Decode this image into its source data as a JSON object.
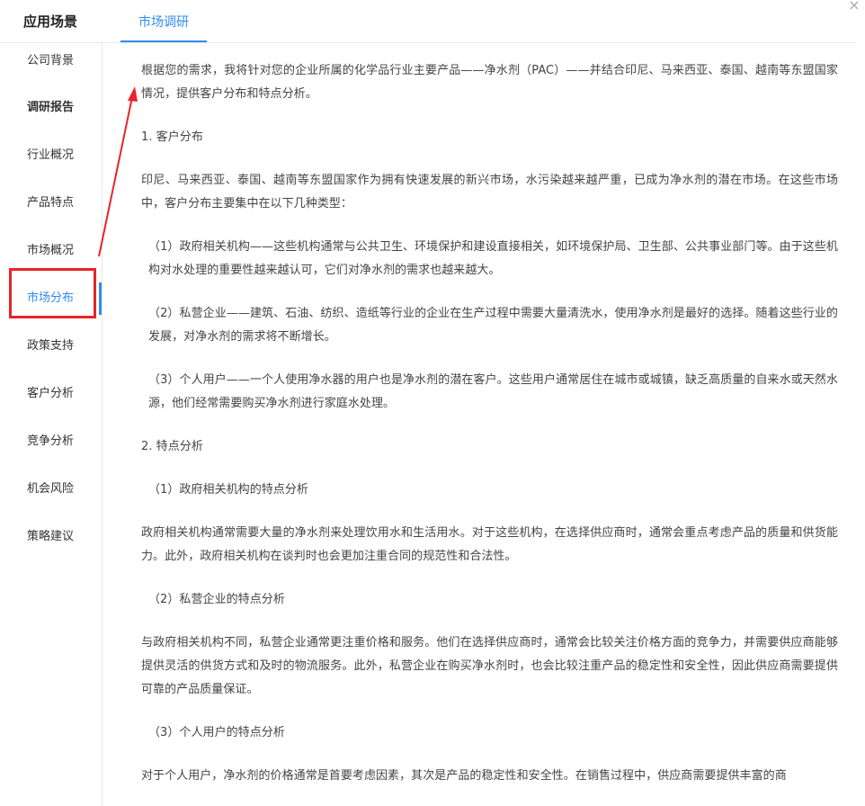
{
  "header": {
    "title": "应用场景",
    "tab_label": "市场调研",
    "close_glyph": "×"
  },
  "sidebar": {
    "items": [
      {
        "label": "公司背景"
      },
      {
        "label": "调研报告"
      },
      {
        "label": "行业概况"
      },
      {
        "label": "产品特点"
      },
      {
        "label": "市场概况"
      },
      {
        "label": "市场分布"
      },
      {
        "label": "政策支持"
      },
      {
        "label": "客户分析"
      },
      {
        "label": "竞争分析"
      },
      {
        "label": "机会风险"
      },
      {
        "label": "策略建议"
      }
    ],
    "active_label": "市场分布"
  },
  "content": {
    "paragraphs": [
      "根据您的需求，我将针对您的企业所属的化学品行业主要产品——净水剂（PAC）——并结合印尼、马来西亚、泰国、越南等东盟国家情况，提供客户分布和特点分析。",
      "1. 客户分布",
      "印尼、马来西亚、泰国、越南等东盟国家作为拥有快速发展的新兴市场，水污染越来越严重，已成为净水剂的潜在市场。在这些市场中，客户分布主要集中在以下几种类型：",
      "（1）政府相关机构——这些机构通常与公共卫生、环境保护和建设直接相关，如环境保护局、卫生部、公共事业部门等。由于这些机构对水处理的重要性越来越认可，它们对净水剂的需求也越来越大。",
      "（2）私营企业——建筑、石油、纺织、造纸等行业的企业在生产过程中需要大量清洗水，使用净水剂是最好的选择。随着这些行业的发展，对净水剂的需求将不断增长。",
      "（3）个人用户——一个人使用净水器的用户也是净水剂的潜在客户。这些用户通常居住在城市或城镇，缺乏高质量的自来水或天然水源，他们经常需要购买净水剂进行家庭水处理。",
      "2. 特点分析",
      "（1）政府相关机构的特点分析",
      "政府相关机构通常需要大量的净水剂来处理饮用水和生活用水。对于这些机构，在选择供应商时，通常会重点考虑产品的质量和供货能力。此外，政府相关机构在谈判时也会更加注重合同的规范性和合法性。",
      "（2）私营企业的特点分析",
      "与政府相关机构不同，私营企业通常更注重价格和服务。他们在选择供应商时，通常会比较关注价格方面的竞争力，并需要供应商能够提供灵活的供货方式和及时的物流服务。此外，私营企业在购买净水剂时，也会比较注重产品的稳定性和安全性，因此供应商需要提供可靠的产品质量保证。",
      "（3）个人用户的特点分析",
      "对于个人用户，净水剂的价格通常是首要考虑因素，其次是产品的稳定性和安全性。在销售过程中，供应商需要提供丰富的商"
    ]
  },
  "colors": {
    "accent": "#2d8cf0",
    "highlight_red": "#e8232a",
    "text": "#444444"
  }
}
